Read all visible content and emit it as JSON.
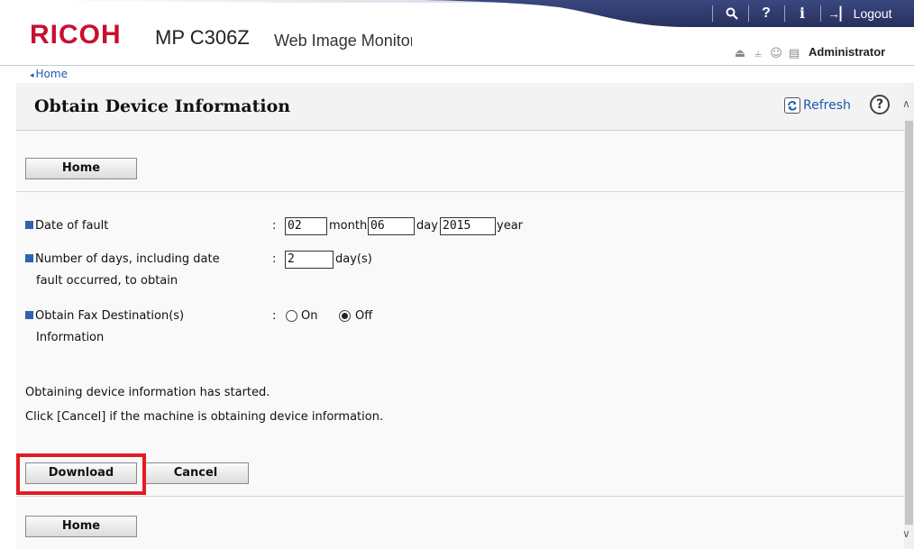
{
  "header": {
    "logo": "RICOH",
    "model": "MP C306Z",
    "app_title": "Web Image Monitor",
    "toolbar": {
      "search_icon": "search-icon",
      "help_glyph": "?",
      "info_glyph": "i",
      "logout_label": "Logout"
    },
    "user_label": "Administrator",
    "status_icons": [
      "printer-icon",
      "network-icon",
      "user-icon",
      "document-icon"
    ]
  },
  "breadcrumb": {
    "home_label": "Home"
  },
  "page": {
    "title": "Obtain Device Information",
    "refresh_label": "Refresh",
    "help_glyph": "?"
  },
  "buttons": {
    "home_top": "Home",
    "download": "Download",
    "cancel": "Cancel",
    "home_bottom": "Home"
  },
  "form": {
    "date_of_fault": {
      "label": "Date of fault",
      "colon": ":",
      "month_value": "02",
      "month_unit": "month",
      "day_value": "06",
      "day_unit": "day",
      "year_value": "2015",
      "year_unit": "year"
    },
    "days": {
      "label_line1": "Number of days, including date",
      "label_line2": "fault occurred, to obtain",
      "colon": ":",
      "value": "2",
      "unit": "day(s)"
    },
    "fax": {
      "label_line1": "Obtain Fax Destination(s)",
      "label_line2": "Information",
      "colon": ":",
      "on_label": "On",
      "off_label": "Off",
      "selected": "Off"
    }
  },
  "messages": {
    "line1": "Obtaining device information has started.",
    "line2": "Click [Cancel] if the machine is obtaining device information."
  },
  "colors": {
    "brand_red": "#c8102e",
    "toolbar_navy": "#2e3a6e",
    "link_blue": "#1a5bb0",
    "highlight_red": "#e21c24",
    "bullet_blue": "#2f62b0"
  }
}
